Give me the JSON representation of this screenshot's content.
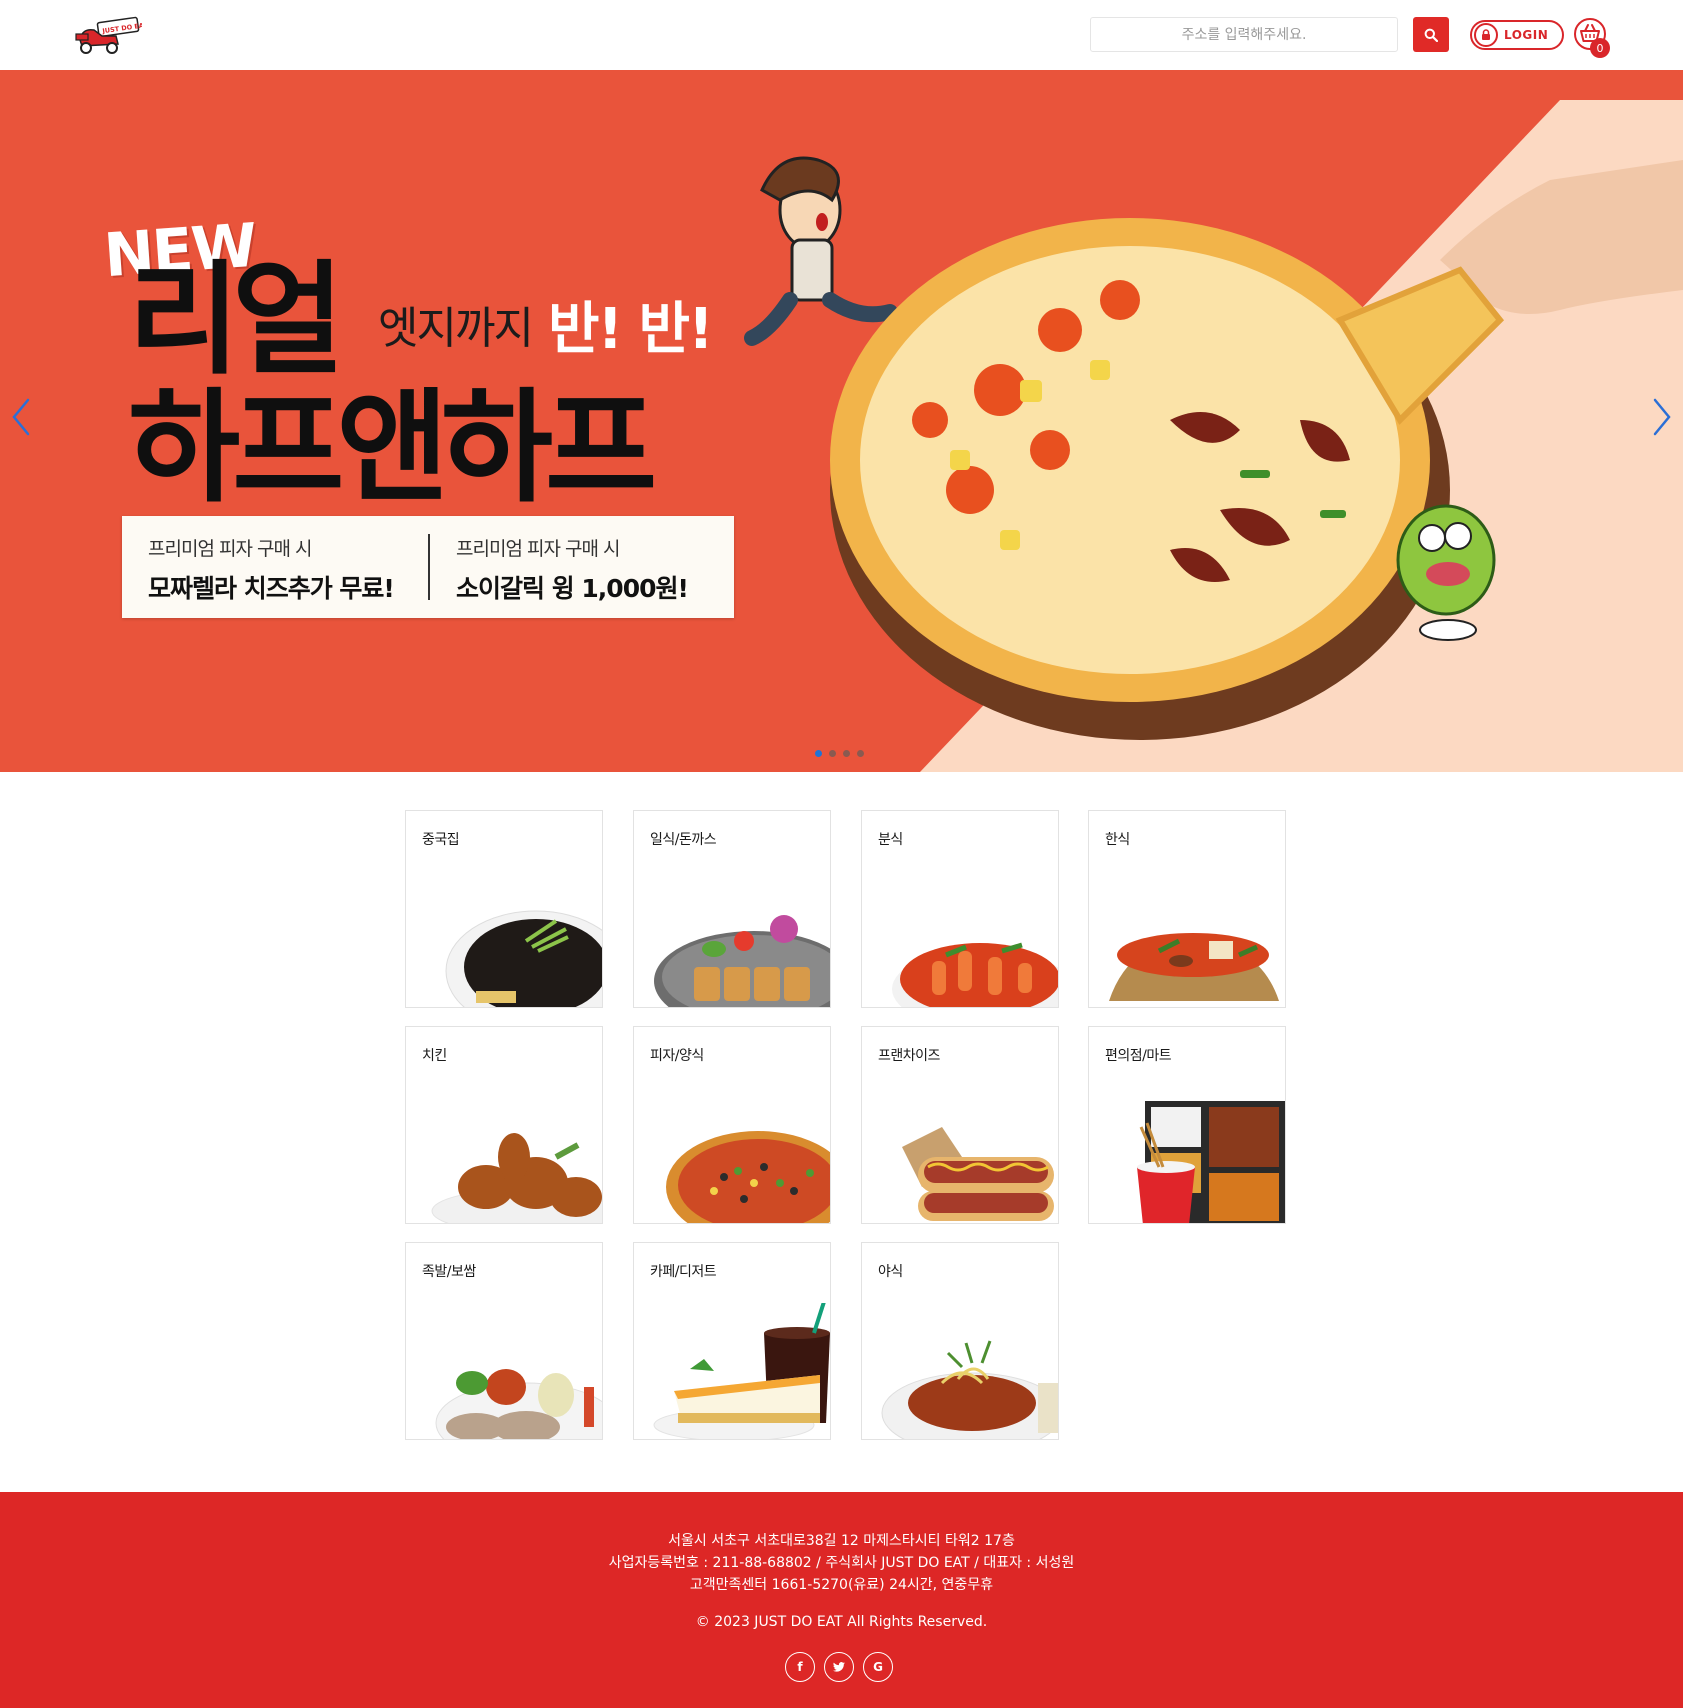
{
  "header": {
    "logo_text": "JUST DO EAT",
    "search": {
      "placeholder": "주소를 입력해주세요."
    },
    "login_label": "LOGIN",
    "cart_count": "0"
  },
  "banner": {
    "new_label": "NEW",
    "headline_line1": "리얼",
    "headline_line2": "하프앤하프",
    "sub_text": "엣지까지",
    "sub_emphasis": "반! 반!",
    "promos": [
      {
        "small": "프리미엄 피자 구매 시",
        "big": "모짜렐라 치즈추가 무료!"
      },
      {
        "small": "프리미엄 피자 구매 시",
        "big": "소이갈릭 윙 1,000원!"
      }
    ],
    "slide_count": 4,
    "active_slide": 1
  },
  "categories": [
    {
      "label": "중국집"
    },
    {
      "label": "일식/돈까스"
    },
    {
      "label": "분식"
    },
    {
      "label": "한식"
    },
    {
      "label": "치킨"
    },
    {
      "label": "피자/양식"
    },
    {
      "label": "프랜차이즈"
    },
    {
      "label": "편의점/마트"
    },
    {
      "label": "족발/보쌈"
    },
    {
      "label": "카페/디저트"
    },
    {
      "label": "야식"
    }
  ],
  "footer": {
    "address": "서울시 서초구 서초대로38길 12 마제스타시티 타워2 17층",
    "business": "사업자등록번호 : 211-88-68802 / 주식회사 JUST DO EAT / 대표자 : 서성원",
    "service": "고객만족센터 1661-5270(유료) 24시간, 연중무휴",
    "copyright": "© 2023 JUST DO EAT All Rights Reserved.",
    "socials": [
      "facebook-icon",
      "twitter-icon",
      "google-icon"
    ]
  },
  "colors": {
    "brand_red": "#dd2726",
    "banner_orange": "#e9543b",
    "banner_peach": "#fcd9c2",
    "slider_active": "#1e73d6"
  }
}
